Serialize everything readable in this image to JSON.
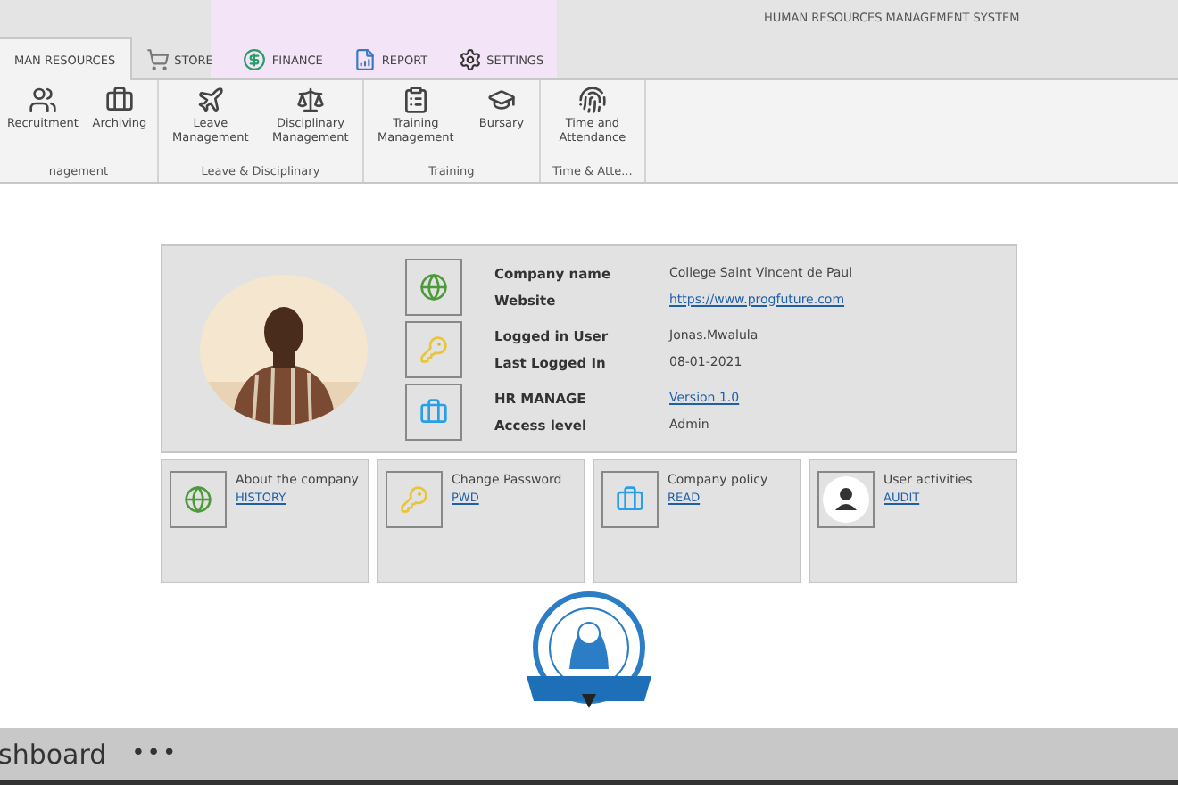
{
  "window": {
    "title": "HUMAN RESOURCES MANAGEMENT SYSTEM"
  },
  "tabs": [
    {
      "label": "MAN RESOURCES",
      "selected": true
    },
    {
      "label": "STORE",
      "selected": false
    },
    {
      "label": "FINANCE",
      "selected": false
    },
    {
      "label": "REPORT",
      "selected": false
    },
    {
      "label": "SETTINGS",
      "selected": false
    }
  ],
  "ribbon": [
    {
      "label": "nagement",
      "items": [
        {
          "label": "Recruitment"
        },
        {
          "label": "Archiving"
        }
      ]
    },
    {
      "label": "Leave & Disciplinary",
      "items": [
        {
          "label": "Leave Management"
        },
        {
          "label": "Disciplinary Management"
        }
      ]
    },
    {
      "label": "Training",
      "items": [
        {
          "label": "Training Management"
        },
        {
          "label": "Bursary"
        }
      ]
    },
    {
      "label": "Time & Atte...",
      "items": [
        {
          "label": "Time and Attendance"
        }
      ]
    }
  ],
  "profile": {
    "rows": [
      {
        "fields": [
          {
            "label": "Company name",
            "value": "College Saint Vincent de Paul",
            "link": false
          },
          {
            "label": "Website",
            "value": "https://www.progfuture.com",
            "link": true
          }
        ]
      },
      {
        "fields": [
          {
            "label": "Logged in User",
            "value": "Jonas.Mwalula",
            "link": false
          },
          {
            "label": "Last Logged In",
            "value": "08-01-2021",
            "link": false
          }
        ]
      },
      {
        "fields": [
          {
            "label": "HR MANAGE",
            "value": "Version 1.0",
            "link": true
          },
          {
            "label": "Access level",
            "value": "Admin",
            "link": false
          }
        ]
      }
    ]
  },
  "cards": [
    {
      "title": "About the company",
      "link": "HISTORY"
    },
    {
      "title": "Change Password",
      "link": "PWD"
    },
    {
      "title": "Company policy",
      "link": "READ"
    },
    {
      "title": "User activities",
      "link": "AUDIT"
    }
  ],
  "taskbar": {
    "label": "shboard",
    "more": "•••"
  }
}
